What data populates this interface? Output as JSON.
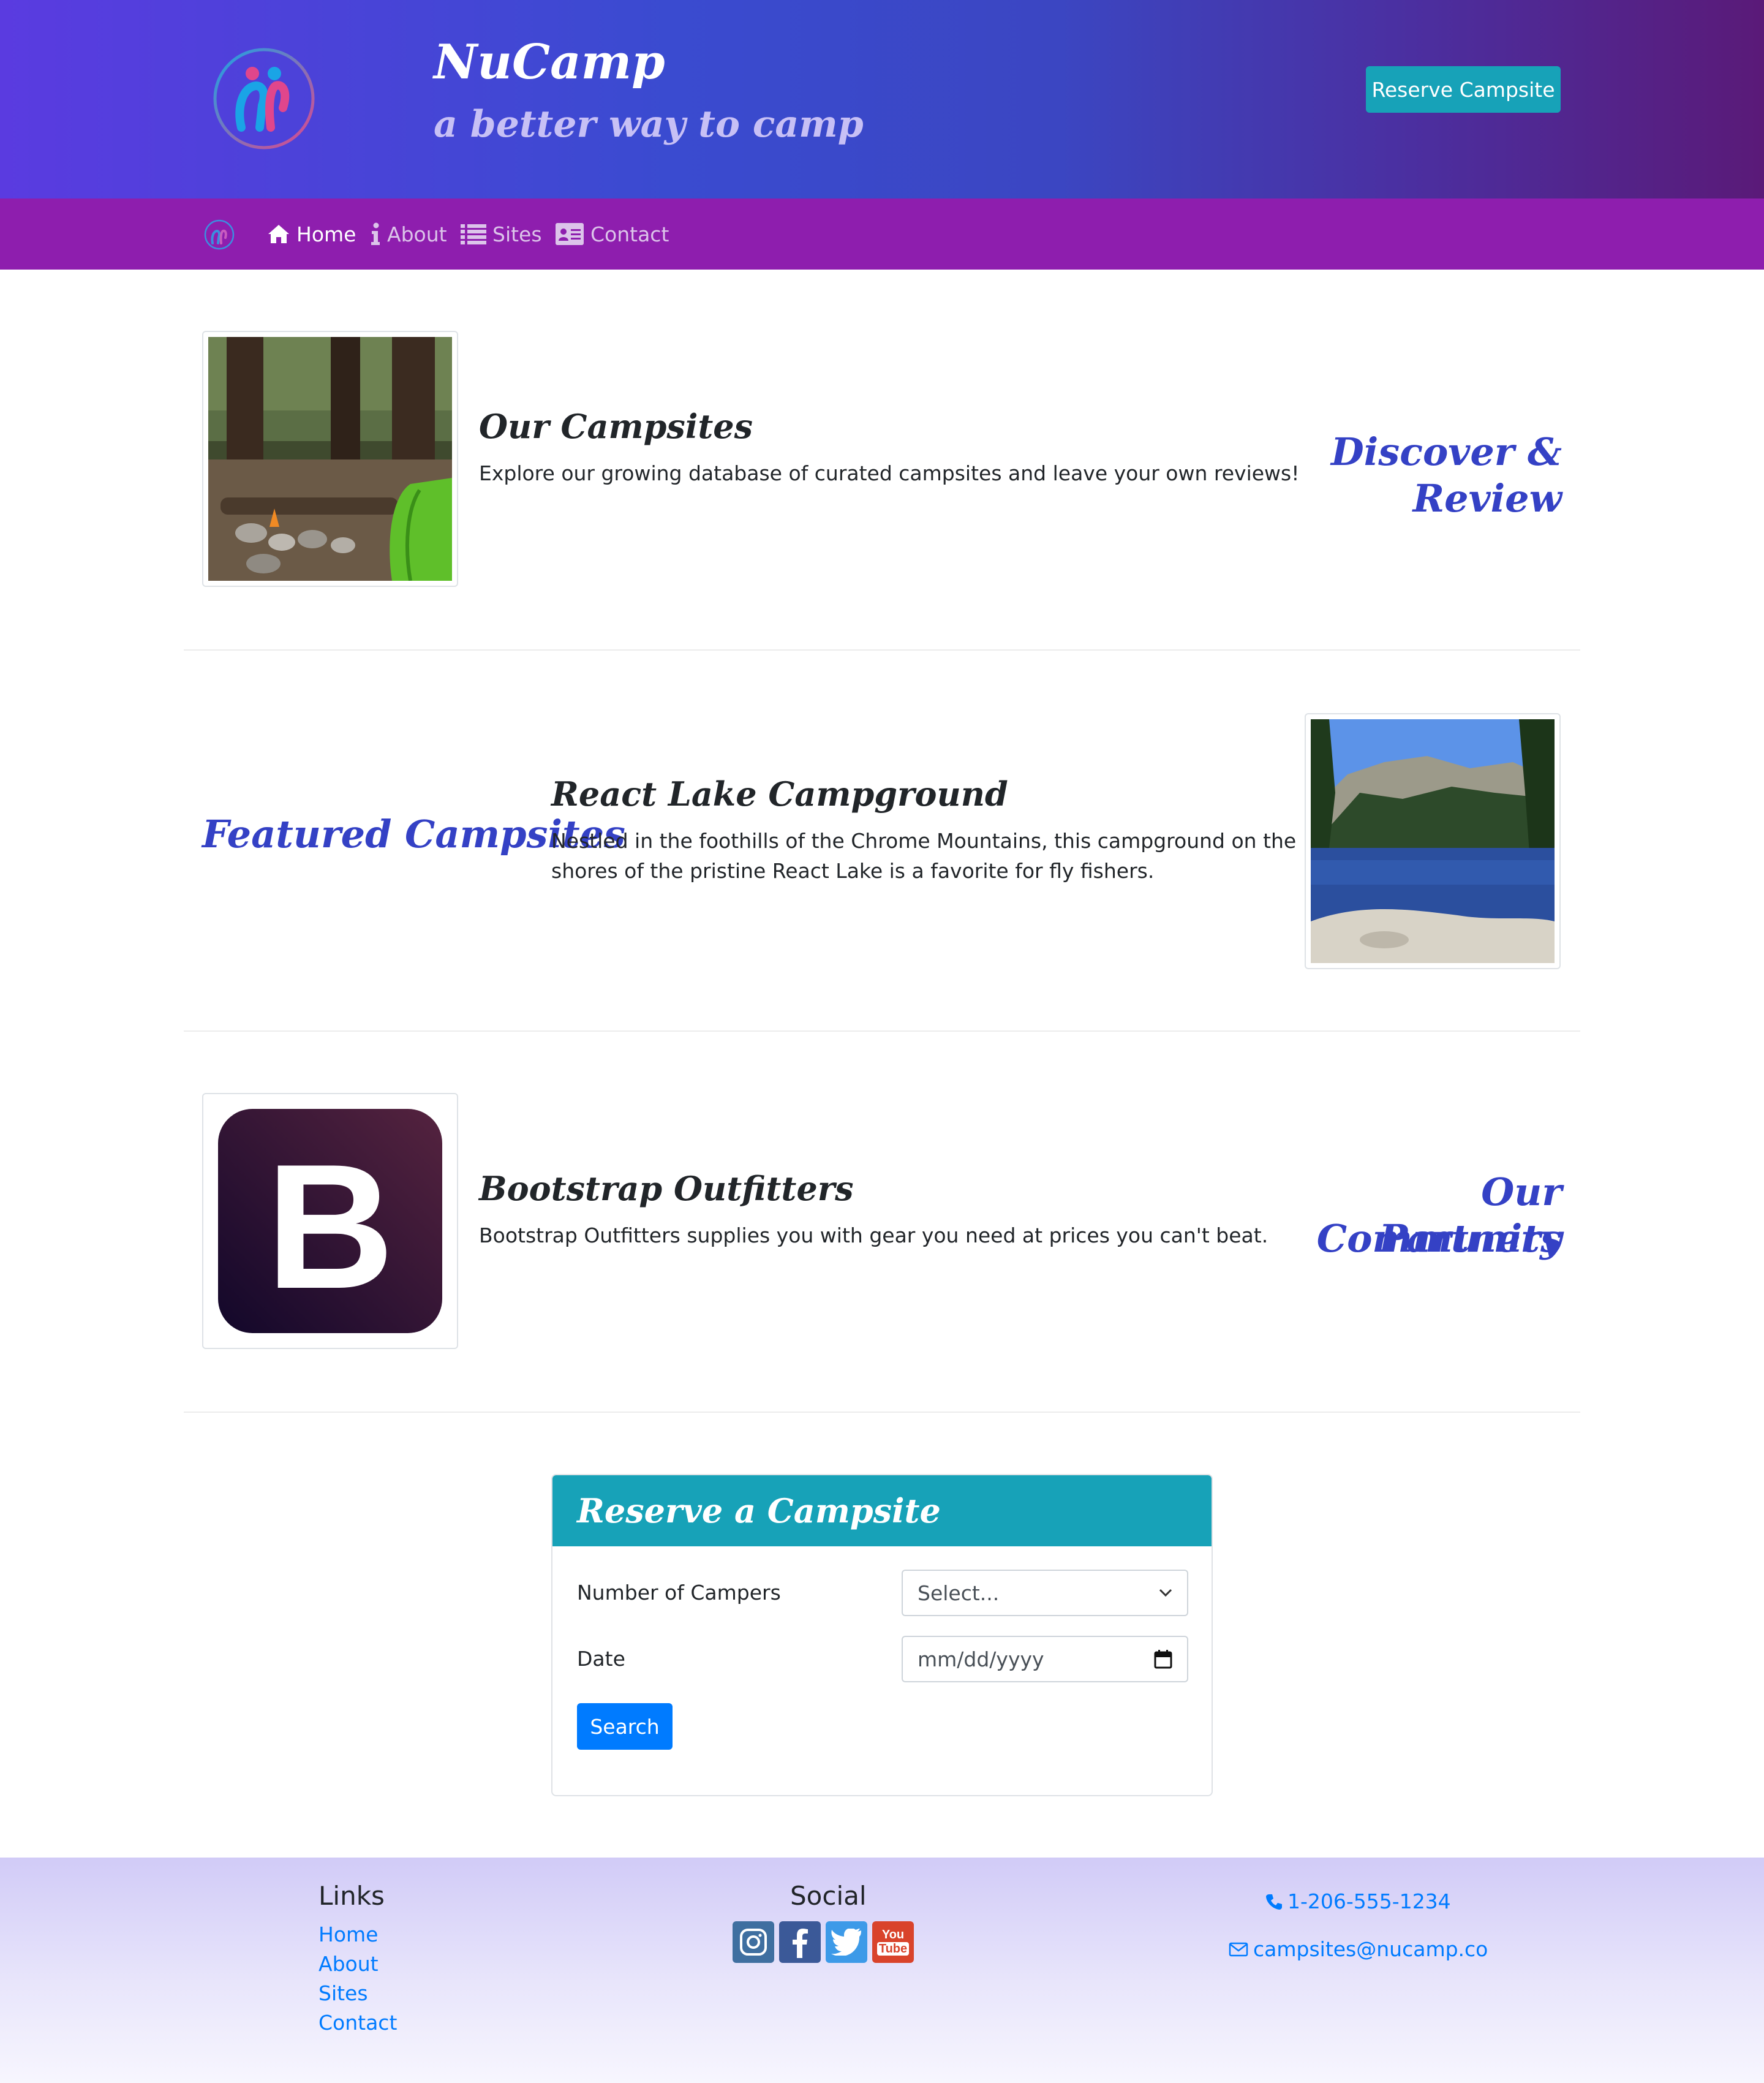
{
  "header": {
    "brand_title": "NuCamp",
    "brand_subtitle": "a better way to camp",
    "reserve_button": "Reserve Campsite"
  },
  "nav": {
    "items": [
      {
        "label": "Home",
        "icon": "home-icon",
        "active": true
      },
      {
        "label": "About",
        "icon": "info-icon",
        "active": false
      },
      {
        "label": "Sites",
        "icon": "list-icon",
        "active": false
      },
      {
        "label": "Contact",
        "icon": "address-card-icon",
        "active": false
      }
    ]
  },
  "sections": [
    {
      "title": "Our Campsites",
      "text": "Explore our growing database of curated campsites and leave your own reviews!",
      "side_heading": "Discover & Review",
      "image": "campfire-forest-photo"
    },
    {
      "title": "React Lake Campground",
      "text_line1": "Nestled in the foothills of the Chrome Mountains, this campground on the",
      "text_line2": "shores of the pristine React Lake is a favorite for fly fishers.",
      "side_heading": "Featured Campsites",
      "image": "lake-photo"
    },
    {
      "title": "Bootstrap Outfitters",
      "text": "Bootstrap Outfitters supplies you with gear you need at prices you can't beat.",
      "side_heading_line1": "Our Community",
      "side_heading_line2": "Partners",
      "image": "bootstrap-logo"
    }
  ],
  "reserve_form": {
    "title": "Reserve a Campsite",
    "campers_label": "Number of Campers",
    "campers_value": "Select...",
    "date_label": "Date",
    "date_value": "mm/dd/yyyy",
    "search_button": "Search"
  },
  "footer": {
    "links_heading": "Links",
    "links": [
      "Home",
      "About",
      "Sites",
      "Contact"
    ],
    "social_heading": "Social",
    "social_icons": [
      "instagram-icon",
      "facebook-icon",
      "twitter-icon",
      "youtube-icon"
    ],
    "youtube_line1": "You",
    "youtube_line2": "Tube",
    "phone": "1-206-555-1234",
    "email": "campsites@nucamp.co"
  },
  "colors": {
    "accent_teal": "#17a2b8",
    "nav_purple": "#8e1eae",
    "heading_blue": "#3441c5",
    "link_blue": "#007bff"
  }
}
